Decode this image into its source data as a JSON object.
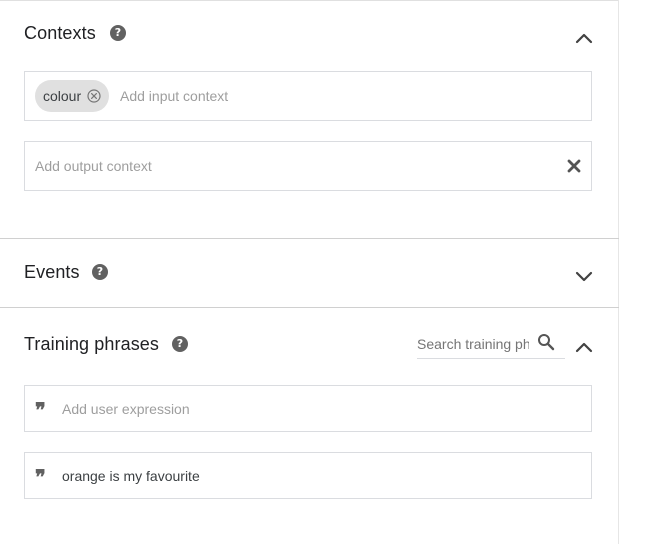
{
  "contexts": {
    "title": "Contexts",
    "input": {
      "chips": [
        {
          "label": "colour"
        }
      ],
      "placeholder": "Add input context"
    },
    "output": {
      "placeholder": "Add output context"
    }
  },
  "events": {
    "title": "Events"
  },
  "training_phrases": {
    "title": "Training phrases",
    "search_placeholder": "Search training phrases",
    "add_placeholder": "Add user expression",
    "phrases": [
      "orange is my favourite"
    ]
  },
  "icons": {
    "help": "help-circle-icon",
    "chevron_up": "chevron-up-icon",
    "chevron_down": "chevron-down-icon",
    "search": "search-icon",
    "close": "close-icon",
    "quote": "quote-icon"
  },
  "colors": {
    "chip_bg": "#e0e0e0",
    "icon": "#616161",
    "border": "#dadce0"
  }
}
